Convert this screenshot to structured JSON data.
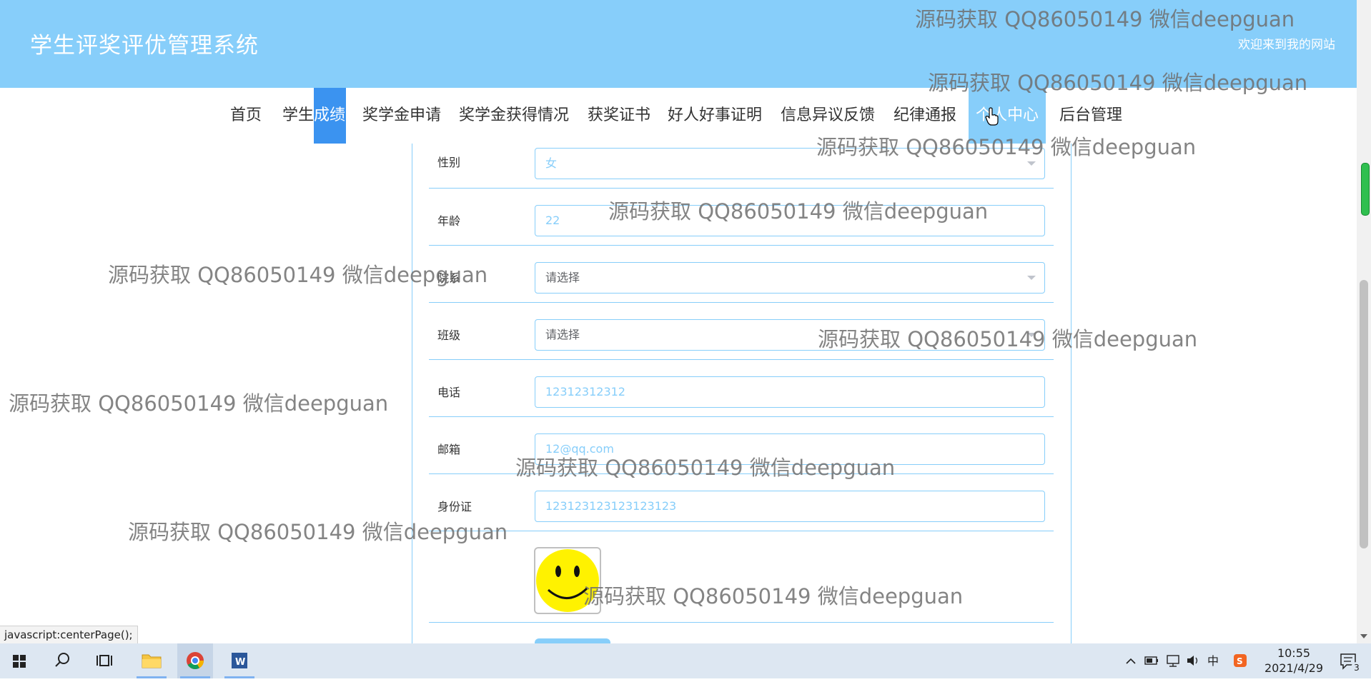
{
  "header": {
    "site_title": "学生评奖评优管理系统",
    "welcome": "欢迎来到我的网站"
  },
  "nav": {
    "items": [
      "首页",
      "学生",
      "奖学金申请",
      "奖学金获得情况",
      "获奖证书",
      "好人好事证明",
      "信息异议反馈",
      "纪律通报",
      "个人中心",
      "后台管理"
    ],
    "highlight_text": "成绩"
  },
  "form": {
    "rows": [
      {
        "label": "性别",
        "value": "女",
        "type": "select"
      },
      {
        "label": "年龄",
        "value": "22",
        "type": "input"
      },
      {
        "label": "院系",
        "placeholder": "请选择",
        "type": "select"
      },
      {
        "label": "班级",
        "placeholder": "请选择",
        "type": "select"
      },
      {
        "label": "电话",
        "value": "12312312312",
        "type": "input"
      },
      {
        "label": "邮箱",
        "value": "12@qq.com",
        "type": "input"
      },
      {
        "label": "身份证",
        "value": "123123123123123123",
        "type": "input"
      }
    ]
  },
  "status_url": "javascript:centerPage();",
  "watermark": "源码获取 QQ86050149 微信deepguan",
  "taskbar": {
    "time": "10:55",
    "date": "2021/4/29",
    "ime": "中",
    "notification_count": "3"
  },
  "colors": {
    "header_bg": "#87cefa",
    "nav_highlight": "#3b93f0",
    "field_border": "#87cefa"
  }
}
